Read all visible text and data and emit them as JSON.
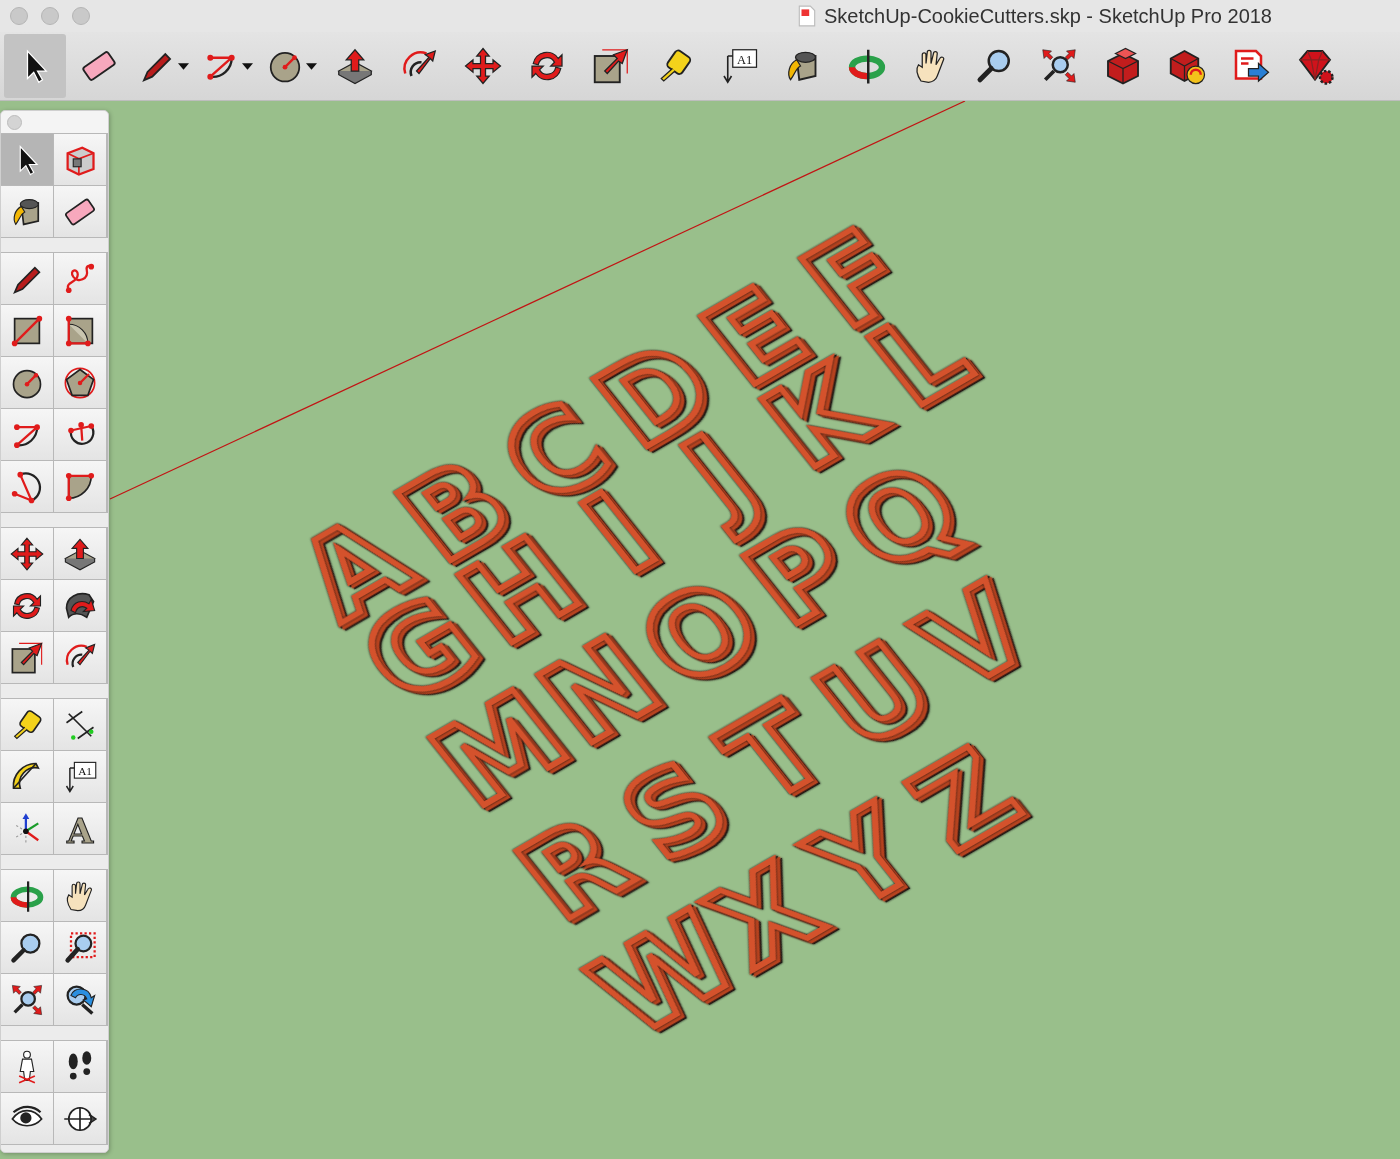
{
  "window": {
    "title": "SketchUp-CookieCutters.skp - SketchUp Pro 2018"
  },
  "toolbar": [
    {
      "kind": "select",
      "selected": true,
      "dropdown": false
    },
    {
      "kind": "eraser",
      "selected": false,
      "dropdown": false
    },
    {
      "kind": "pencil",
      "selected": false,
      "dropdown": true
    },
    {
      "kind": "arc",
      "selected": false,
      "dropdown": true
    },
    {
      "kind": "circle",
      "selected": false,
      "dropdown": true
    },
    {
      "kind": "pushpull",
      "selected": false,
      "dropdown": false
    },
    {
      "kind": "offset",
      "selected": false,
      "dropdown": false
    },
    {
      "kind": "move",
      "selected": false,
      "dropdown": false
    },
    {
      "kind": "rotate",
      "selected": false,
      "dropdown": false
    },
    {
      "kind": "scale",
      "selected": false,
      "dropdown": false
    },
    {
      "kind": "tape",
      "selected": false,
      "dropdown": false
    },
    {
      "kind": "text",
      "label": "A1",
      "selected": false,
      "dropdown": false
    },
    {
      "kind": "paint",
      "selected": false,
      "dropdown": false
    },
    {
      "kind": "orbit",
      "selected": false,
      "dropdown": false
    },
    {
      "kind": "pan",
      "selected": false,
      "dropdown": false
    },
    {
      "kind": "zoom",
      "selected": false,
      "dropdown": false
    },
    {
      "kind": "extents",
      "selected": false,
      "dropdown": false
    },
    {
      "kind": "warehouse",
      "selected": false,
      "dropdown": false
    },
    {
      "kind": "extension",
      "selected": false,
      "dropdown": false
    },
    {
      "kind": "layout",
      "selected": false,
      "dropdown": false
    },
    {
      "kind": "ruby",
      "selected": false,
      "dropdown": false
    }
  ],
  "tool_palette": {
    "groups": [
      [
        {
          "kind": "select",
          "selected": true
        },
        {
          "kind": "component",
          "selected": false
        },
        {
          "kind": "paint",
          "selected": false
        },
        {
          "kind": "eraser",
          "selected": false
        }
      ],
      [
        {
          "kind": "pencil",
          "selected": false
        },
        {
          "kind": "freehand",
          "selected": false
        },
        {
          "kind": "rectangle",
          "selected": false
        },
        {
          "kind": "rounded",
          "selected": false
        },
        {
          "kind": "circle",
          "selected": false
        },
        {
          "kind": "polygon",
          "selected": false
        },
        {
          "kind": "arc",
          "selected": false
        },
        {
          "kind": "arc2",
          "selected": false
        },
        {
          "kind": "arc3",
          "selected": false
        },
        {
          "kind": "pie",
          "selected": false
        }
      ],
      [
        {
          "kind": "move",
          "selected": false
        },
        {
          "kind": "pushpull",
          "selected": false
        },
        {
          "kind": "rotate",
          "selected": false
        },
        {
          "kind": "followme",
          "selected": false
        },
        {
          "kind": "scale",
          "selected": false
        },
        {
          "kind": "offset",
          "selected": false
        }
      ],
      [
        {
          "kind": "tape",
          "selected": false
        },
        {
          "kind": "dimension",
          "selected": false
        },
        {
          "kind": "protractor",
          "selected": false
        },
        {
          "kind": "text",
          "label": "A1",
          "selected": false
        },
        {
          "kind": "axes",
          "selected": false
        },
        {
          "kind": "text3d",
          "label": "A",
          "selected": false
        }
      ],
      [
        {
          "kind": "orbit",
          "selected": false
        },
        {
          "kind": "pan",
          "selected": false
        },
        {
          "kind": "zoom",
          "selected": false
        },
        {
          "kind": "zoomwindow",
          "selected": false
        },
        {
          "kind": "extents",
          "selected": false
        },
        {
          "kind": "previous",
          "selected": false
        }
      ],
      [
        {
          "kind": "camera",
          "selected": false
        },
        {
          "kind": "walk",
          "selected": false
        },
        {
          "kind": "lookaround",
          "selected": false
        },
        {
          "kind": "section",
          "selected": false
        }
      ]
    ]
  },
  "viewport": {
    "model_rows": [
      [
        "A",
        "B",
        "C",
        "D",
        "E",
        "F"
      ],
      [
        "G",
        "H",
        "I",
        "J",
        "K",
        "L"
      ],
      [
        "M",
        "N",
        "O",
        "P",
        "Q"
      ],
      [
        "R",
        "S",
        "T",
        "U",
        "V"
      ],
      [
        "W",
        "X",
        "Y",
        "Z"
      ]
    ]
  }
}
